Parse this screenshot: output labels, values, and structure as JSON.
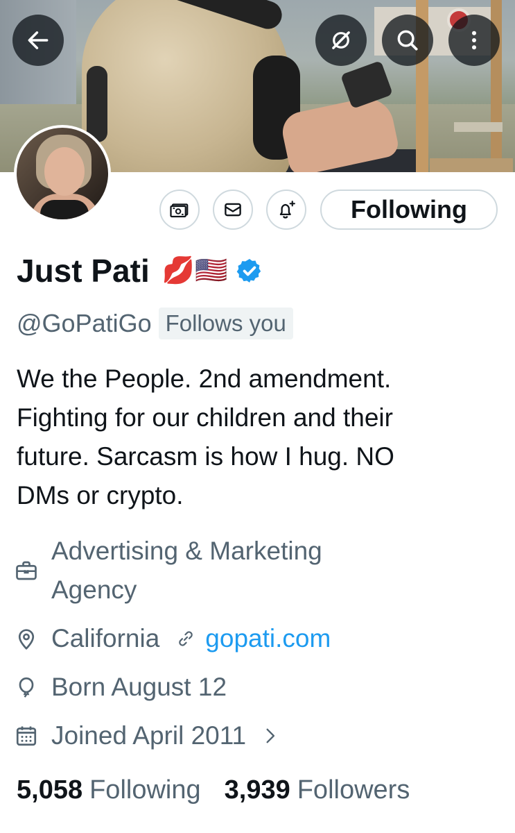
{
  "header": {
    "back_icon": "arrow-left-icon",
    "grok_icon": "grok-icon",
    "search_icon": "search-icon",
    "more_icon": "more-vertical-icon"
  },
  "actions": {
    "tip_icon": "money-icon",
    "message_icon": "mail-icon",
    "notify_icon": "bell-plus-icon",
    "following_label": "Following"
  },
  "profile": {
    "name": "Just Pati",
    "name_emoji": "💋🇺🇸",
    "verified_icon": "verified-badge-icon",
    "handle": "@GoPatiGo",
    "follows_you": "Follows you",
    "bio_lines": [
      "We the People. 2nd amendment.",
      "Fighting for our children and their",
      "future. Sarcasm is how I hug. NO",
      "DMs or crypto."
    ],
    "category_lines": [
      "Advertising & Marketing",
      "Agency"
    ],
    "location": "California",
    "website": "gopati.com",
    "birthday": "Born August 12",
    "joined": "Joined April 2011"
  },
  "stats": {
    "following_count": "5,058",
    "following_label": "Following",
    "followers_count": "3,939",
    "followers_label": "Followers"
  },
  "colors": {
    "text_primary": "#0f1419",
    "text_secondary": "#536471",
    "link": "#1d9bf0",
    "verified": "#1d9bf0",
    "border": "#cfd9de"
  }
}
